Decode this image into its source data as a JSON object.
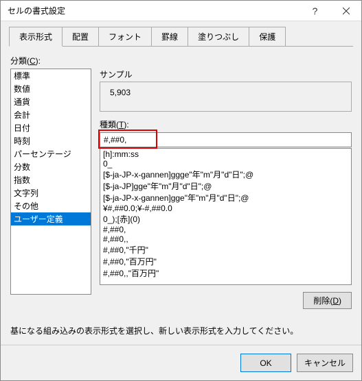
{
  "titlebar": {
    "title": "セルの書式設定"
  },
  "tabs": [
    {
      "label": "表示形式",
      "active": true
    },
    {
      "label": "配置",
      "active": false
    },
    {
      "label": "フォント",
      "active": false
    },
    {
      "label": "罫線",
      "active": false
    },
    {
      "label": "塗りつぶし",
      "active": false
    },
    {
      "label": "保護",
      "active": false
    }
  ],
  "category": {
    "label_pre": "分類(",
    "label_key": "C",
    "label_post": "):",
    "items": [
      "標準",
      "数値",
      "通貨",
      "会計",
      "日付",
      "時刻",
      "パーセンテージ",
      "分数",
      "指数",
      "文字列",
      "その他",
      "ユーザー定義"
    ],
    "selected_index": 11
  },
  "sample": {
    "label": "サンプル",
    "value": "5,903"
  },
  "type": {
    "label_pre": "種類(",
    "label_key": "T",
    "label_post": "):",
    "value": "#,##0,"
  },
  "formats": [
    "[h]:mm:ss",
    "0_ ",
    "[$-ja-JP-x-gannen]ggge\"年\"m\"月\"d\"日\";@",
    "[$-ja-JP]gge\"年\"m\"月\"d\"日\";@",
    "[$-ja-JP-x-gannen]gge\"年\"m\"月\"d\"日\";@",
    "¥#,##0.0;¥-#,##0.0",
    "0_);[赤](0)",
    "#,##0,",
    "#,##0,,",
    "#,##0,\"千円\"",
    "#,##0,\"百万円\"",
    "#,##0,,\"百万円\""
  ],
  "buttons": {
    "delete_pre": "削除(",
    "delete_key": "D",
    "delete_post": ")",
    "ok": "OK",
    "cancel": "キャンセル"
  },
  "instruction": "基になる組み込みの表示形式を選択し、新しい表示形式を入力してください。"
}
